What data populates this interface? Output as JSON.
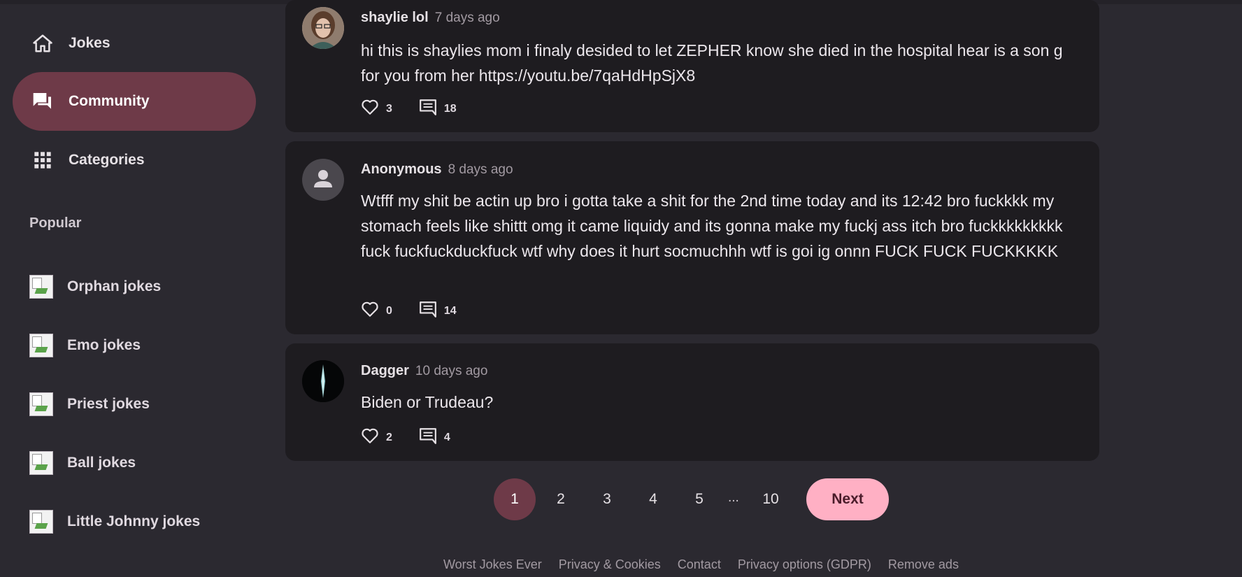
{
  "sidebar": {
    "nav": [
      {
        "label": "Jokes",
        "icon": "home-icon",
        "active": false
      },
      {
        "label": "Community",
        "icon": "forum-icon",
        "active": true
      },
      {
        "label": "Categories",
        "icon": "grid-icon",
        "active": false
      }
    ],
    "popular_title": "Popular",
    "popular": [
      {
        "label": "Orphan jokes"
      },
      {
        "label": "Emo jokes"
      },
      {
        "label": "Priest jokes"
      },
      {
        "label": "Ball jokes"
      },
      {
        "label": "Little Johnny jokes"
      }
    ]
  },
  "posts": [
    {
      "author": "shaylie lol",
      "time": "7 days ago",
      "text": "hi this is shaylies mom i finaly desided to let ZEPHER know she died in the hospital hear is a son g for you from her https://youtu.be/7qaHdHpSjX8",
      "likes": "3",
      "comments": "18"
    },
    {
      "author": "Anonymous",
      "time": "8 days ago",
      "text": "Wtfff my shit be actin up bro i gotta take a shit for the 2nd time today and its 12:42 bro fuckkkk my stomach feels like shittt omg it came liquidy and its gonna make my fuckj ass itch bro fuckkkkkkkkk fuck fuckfuckduckfuck wtf why does it hurt socmuchhh wtf is goi ig onnn FUCK FUCK FUCKKKKK",
      "likes": "0",
      "comments": "14"
    },
    {
      "author": "Dagger",
      "time": "10 days ago",
      "text": "Biden or Trudeau?",
      "likes": "2",
      "comments": "4"
    }
  ],
  "pagination": {
    "pages": [
      "1",
      "2",
      "3",
      "4",
      "5"
    ],
    "ellipsis": "...",
    "last": "10",
    "current": "1",
    "next_label": "Next"
  },
  "footer": {
    "links": [
      "Worst Jokes Ever",
      "Privacy & Cookies",
      "Contact",
      "Privacy options (GDPR)",
      "Remove ads"
    ]
  },
  "colors": {
    "background": "#2b2930",
    "card": "#1e1c20",
    "accent": "#6e3a48",
    "next_button": "#ffb0c4"
  }
}
